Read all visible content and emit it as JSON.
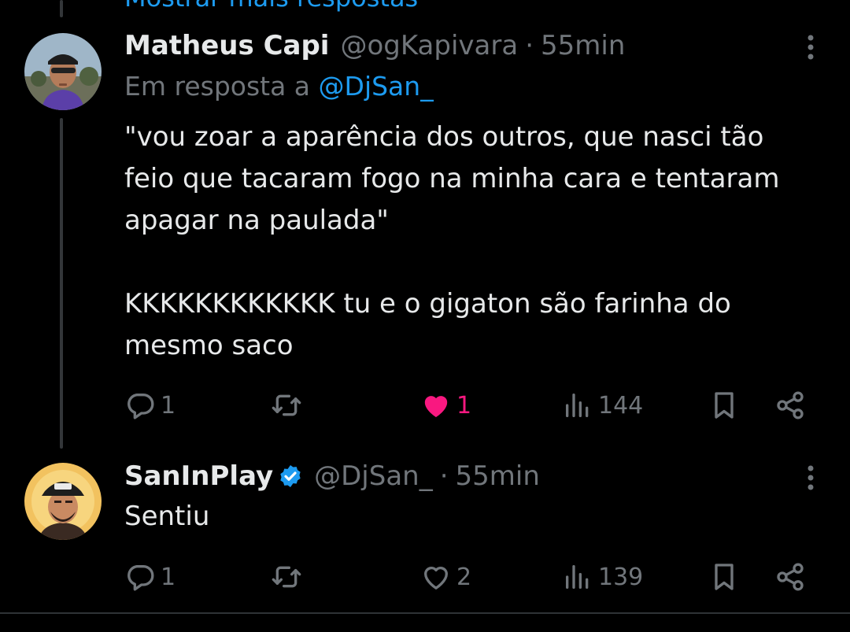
{
  "colors": {
    "background": "#000000",
    "text": "#e7e9ea",
    "muted": "#71767b",
    "link": "#1d9bf0",
    "like": "#f91880"
  },
  "thread": {
    "show_more": "Mostrar mais respostas"
  },
  "tweets": [
    {
      "name": "Matheus Capi",
      "handle": "@ogKapivara",
      "separator": "·",
      "time": "55min",
      "reply_prefix": "Em resposta a ",
      "reply_to": "@DjSan_",
      "text": "\"vou zoar a aparência dos outros, que nasci tão\nfeio que tacaram fogo na minha cara e tentaram\napagar na paulada\"\n\nKKKKKKKKKKKK tu e o gigaton são farinha do\nmesmo saco",
      "replies": "1",
      "retweets": "",
      "likes": "1",
      "liked": true,
      "views": "144",
      "icons": [
        "more-icon",
        "reply-icon",
        "retweet-icon",
        "heart-filled-icon",
        "views-icon",
        "bookmark-icon",
        "share-icon"
      ]
    },
    {
      "name": "SanInPlay",
      "verified": true,
      "handle": "@DjSan_",
      "separator": "·",
      "time": "55min",
      "text": "Sentiu",
      "replies": "1",
      "retweets": "",
      "likes": "2",
      "liked": false,
      "views": "139",
      "icons": [
        "more-icon",
        "verified-badge-icon",
        "reply-icon",
        "retweet-icon",
        "heart-icon",
        "views-icon",
        "bookmark-icon",
        "share-icon"
      ]
    }
  ]
}
